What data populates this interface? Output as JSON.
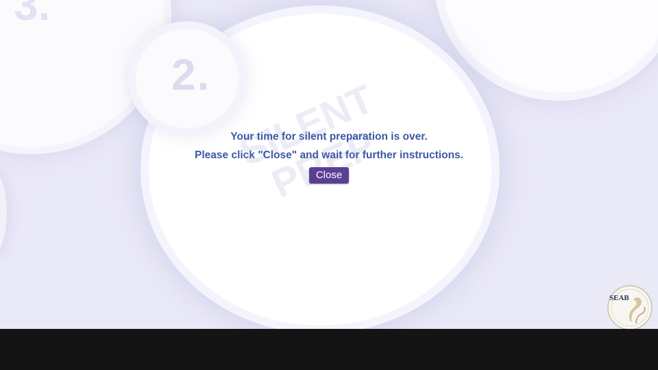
{
  "background": {
    "number_label": "2.",
    "corner_fragment": "3.",
    "watermark": "SILENT\nPREP"
  },
  "dialog": {
    "line1": "Your time for silent preparation is over.",
    "line2": "Please click \"Close\" and wait for further instructions.",
    "close_label": "Close"
  },
  "logo": {
    "text": "SEAB",
    "icon": "seab-lion-logo"
  },
  "colors": {
    "message_text": "#3c5aa3",
    "button_bg": "#5b3f94",
    "background": "#eae9f8",
    "bottom_bar": "#141414"
  }
}
